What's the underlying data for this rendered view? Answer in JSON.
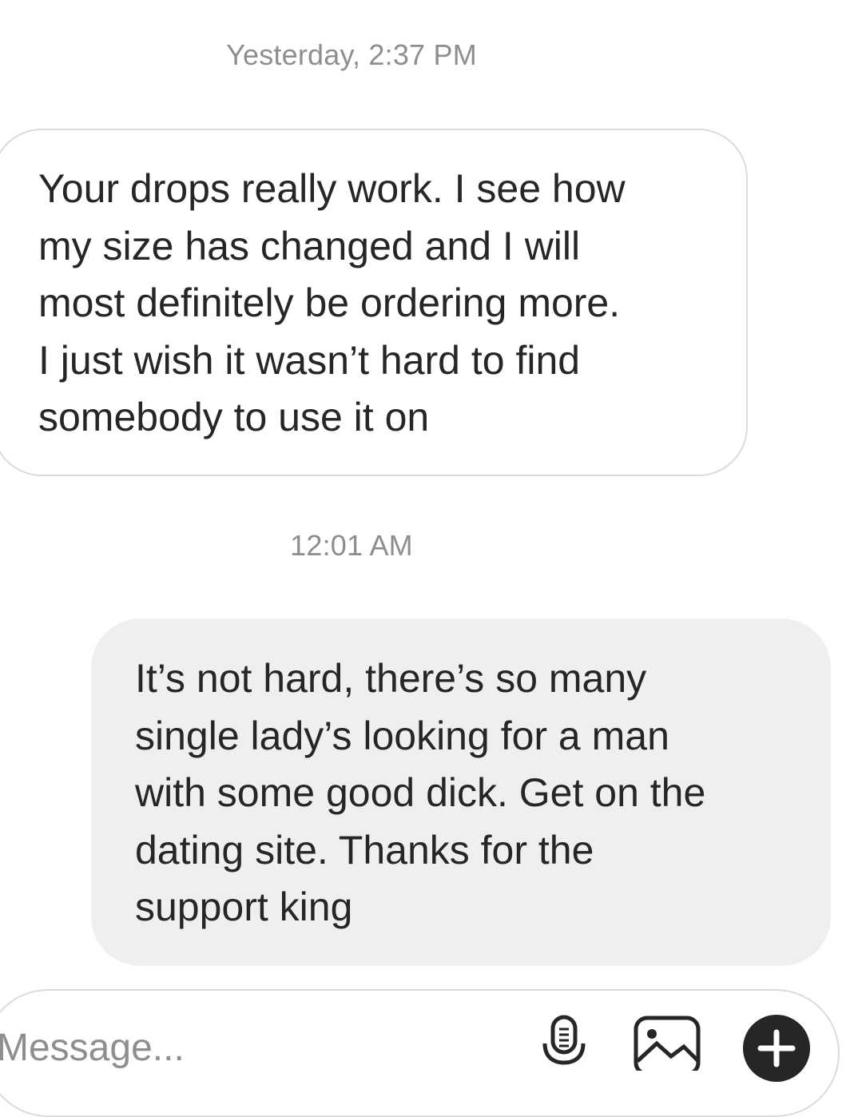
{
  "thread": {
    "messages": [
      {
        "timestamp": "Yesterday, 2:37 PM",
        "direction": "incoming",
        "text": "Your drops really work. I see how\nmy size has changed and I will\nmost definitely be ordering more.\nI just wish it wasn’t hard to find\nsomebody to use it on"
      },
      {
        "timestamp": "12:01 AM",
        "direction": "outgoing",
        "text": "It’s not hard, there’s so many\nsingle lady’s looking for a man\nwith some good dick. Get on the\ndating site. Thanks for the\nsupport king"
      }
    ]
  },
  "composer": {
    "placeholder": "Message...",
    "icons": [
      "microphone-icon",
      "gallery-icon",
      "plus-icon"
    ]
  },
  "colors": {
    "timestamp": "#8e8e8e",
    "incoming_bubble_border": "#dbdbdb",
    "outgoing_bubble_bg": "#efefef",
    "text": "#262626",
    "plus_button": "#262626"
  }
}
